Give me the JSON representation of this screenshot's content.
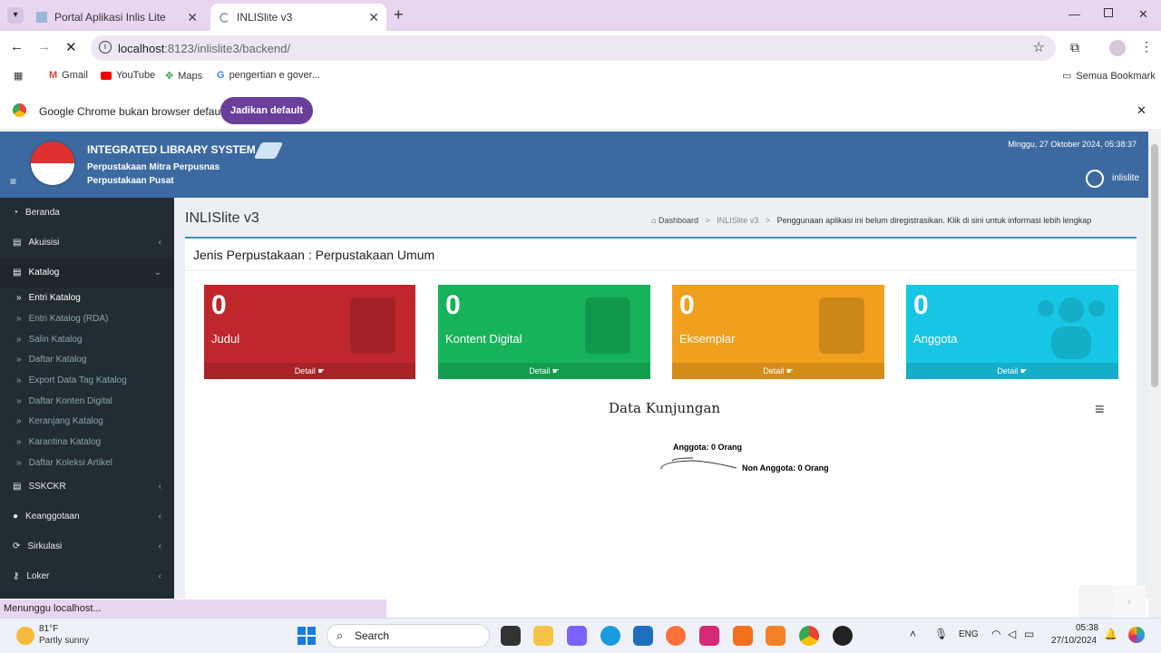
{
  "browser": {
    "tabs": [
      {
        "title": "Portal Aplikasi Inlis Lite"
      },
      {
        "title": "INLISlite v3"
      }
    ],
    "url_host": "localhost",
    "url_rest": ":8123/inlislite3/backend/",
    "bookmarks": [
      "Gmail",
      "YouTube",
      "Maps",
      "pengertian e gover..."
    ],
    "all_bookmarks": "Semua Bookmark",
    "infobar_text": "Google Chrome bukan browser default",
    "infobar_button": "Jadikan default",
    "status": "Menunggu localhost..."
  },
  "app": {
    "title": "INTEGRATED LIBRARY SYSTEM",
    "subtitle1": "Perpustakaan Mitra Perpusnas",
    "subtitle2": "Perpustakaan Pusat",
    "datetime": "Minggu, 27 Oktober 2024, 05:38:37",
    "user": "inlislite",
    "page_title": "INLISlite v3",
    "breadcrumb_home": "Dashboard",
    "breadcrumb_current": "INLISlite v3",
    "notice": "Penggunaan aplikasi ini belum diregistrasikan. Klik di sini untuk informasi lebih lengkap",
    "library_type": "Jenis Perpustakaan : Perpustakaan Umum"
  },
  "sidebar": {
    "items": [
      {
        "label": "Beranda"
      },
      {
        "label": "Akuisisi"
      },
      {
        "label": "Katalog"
      },
      {
        "label": "SSKCKR"
      },
      {
        "label": "Keanggotaan"
      },
      {
        "label": "Sirkulasi"
      },
      {
        "label": "Loker"
      }
    ],
    "katalog_sub": [
      "Entri Katalog",
      "Entri Katalog (RDA)",
      "Salin Katalog",
      "Daftar Katalog",
      "Export Data Tag Katalog",
      "Daftar Konten Digital",
      "Keranjang Katalog",
      "Karantina Katalog",
      "Daftar Koleksi Artikel"
    ]
  },
  "stats": [
    {
      "value": "0",
      "label": "Judul",
      "footer": "Detail",
      "color": "#c0272d"
    },
    {
      "value": "0",
      "label": "Kontent Digital",
      "footer": "Detail",
      "color": "#16b35a"
    },
    {
      "value": "0",
      "label": "Eksemplar",
      "footer": "Detail",
      "color": "#f0a01c"
    },
    {
      "value": "0",
      "label": "Anggota",
      "footer": "Detail",
      "color": "#17c6e4"
    }
  ],
  "chart_data": {
    "type": "pie",
    "title": "Data Kunjungan",
    "data_labels": [
      "Anggota: 0 Orang",
      "Non Anggota: 0 Orang"
    ],
    "values": [
      0,
      0
    ]
  },
  "taskbar": {
    "weather_temp": "81°F",
    "weather_desc": "Partly sunny",
    "search": "Search",
    "lang": "ENG",
    "time": "05:38",
    "date": "27/10/2024"
  }
}
